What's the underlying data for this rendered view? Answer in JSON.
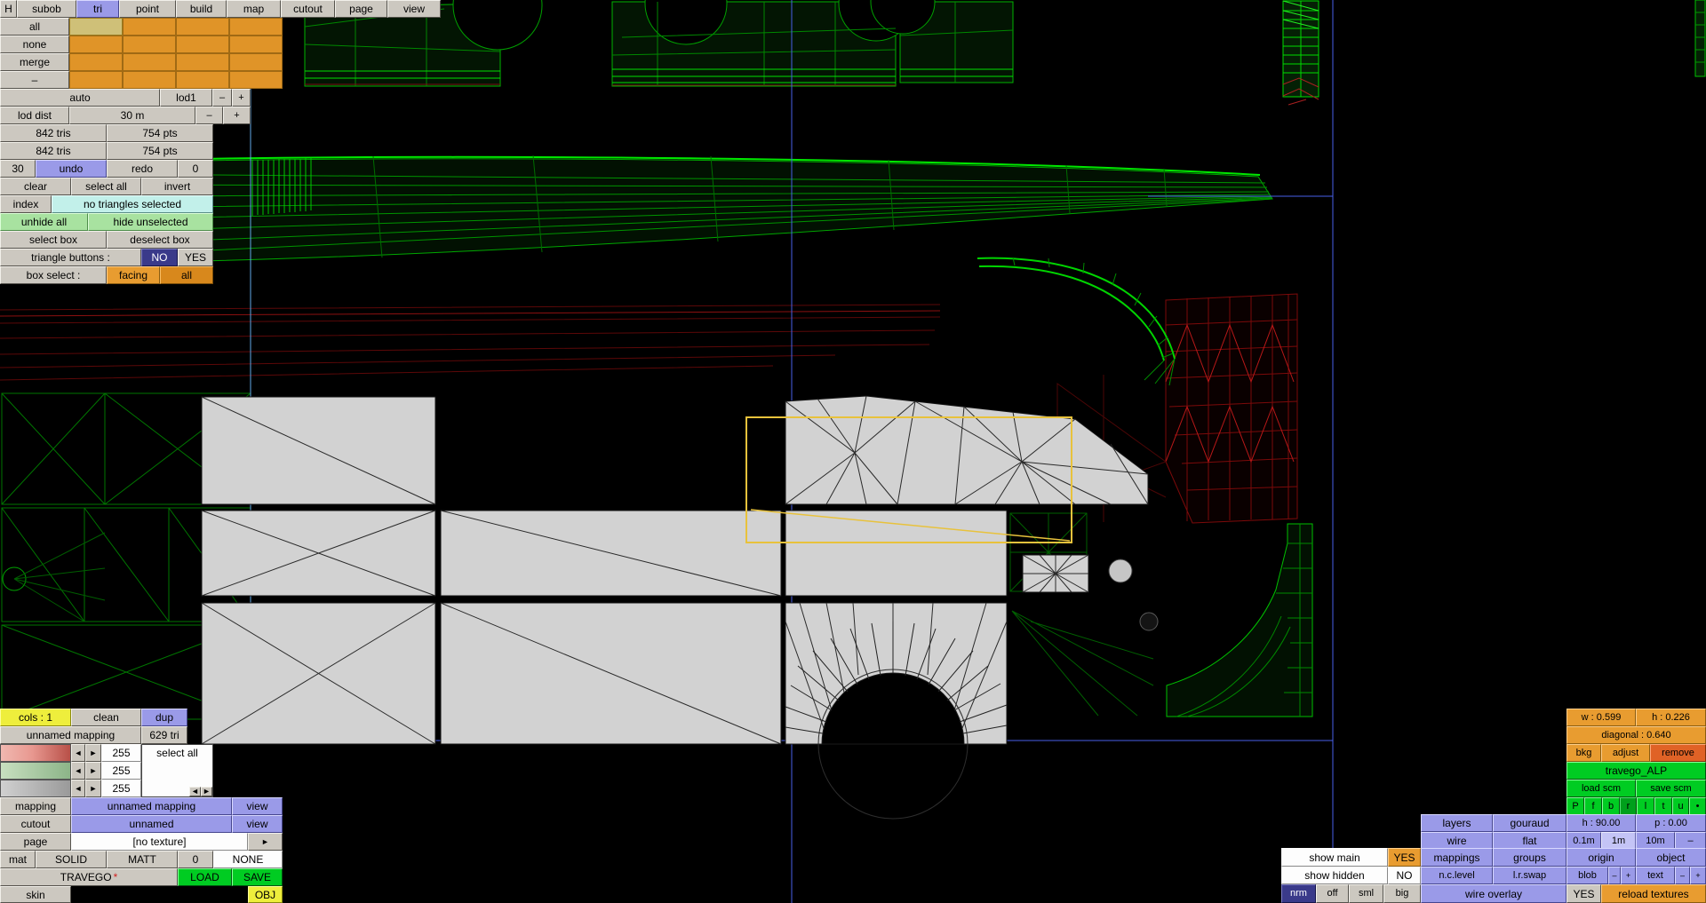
{
  "colors": {
    "accent_orange": "#e89c30",
    "accent_periwinkle": "#9a9ae8",
    "accent_green": "#00cc22",
    "selection_yellow": "#e8c23c",
    "wire_green": "#00b400",
    "guide_blue": "#4860e8"
  },
  "menu": {
    "items": [
      "H",
      "subob",
      "tri",
      "point",
      "build",
      "map",
      "cutout",
      "page",
      "view"
    ]
  },
  "subobj": {
    "row_labels": [
      "all",
      "none",
      "merge",
      "–"
    ]
  },
  "lod": {
    "auto": "auto",
    "lod1": "lod1",
    "minus": "–",
    "plus": "+",
    "dist_label": "lod dist",
    "dist_value": "30 m"
  },
  "stats": {
    "tris1": "842 tris",
    "pts1": "754 pts",
    "tris2": "842 tris",
    "pts2": "754 pts"
  },
  "history": {
    "undo_steps": "30",
    "undo": "undo",
    "redo": "redo",
    "redo_steps": "0"
  },
  "selection": {
    "clear": "clear",
    "select_all": "select all",
    "invert": "invert",
    "index": "index",
    "status": "no triangles selected",
    "unhide_all": "unhide all",
    "hide_unselected": "hide unselected",
    "select_box": "select box",
    "deselect_box": "deselect box",
    "triangle_buttons_label": "triangle buttons :",
    "no": "NO",
    "yes": "YES",
    "box_select_label": "box select :",
    "facing": "facing",
    "all": "all"
  },
  "mapping": {
    "cols": "cols : 1",
    "clean": "clean",
    "dup": "dup",
    "name": "unnamed mapping",
    "tris": "629 tri",
    "select_all": "select all",
    "left": "◄",
    "right": "►",
    "ch1": "255",
    "ch2": "255",
    "ch3": "255",
    "mapping_label": "mapping",
    "mapping_value": "unnamed mapping",
    "mapping_view": "view",
    "cutout_label": "cutout",
    "cutout_value": "unnamed",
    "cutout_view": "view",
    "page_label": "page",
    "page_value": "[no texture]",
    "page_next": "►",
    "mat_label": "mat",
    "mat_solid": "SOLID",
    "mat_matt": "MATT",
    "mat_zero": "0",
    "mat_none": "NONE",
    "file_name": "TRAVEGO",
    "file_star": "*",
    "load": "LOAD",
    "save": "SAVE",
    "skin": "skin",
    "obj": "OBJ"
  },
  "background": {
    "w": "w : 0.599",
    "h": "h : 0.226",
    "diagonal": "diagonal : 0.640",
    "bkg": "bkg",
    "adjust": "adjust",
    "remove": "remove",
    "texture": "travego_ALP",
    "load_scm": "load scm",
    "save_scm": "save scm",
    "views": [
      "P",
      "f",
      "b",
      "r",
      "l",
      "t",
      "u",
      "•"
    ]
  },
  "display": {
    "layers": "layers",
    "gouraud": "gouraud",
    "heading": "h : 90.00",
    "pitch": "p : 0.00",
    "wire": "wire",
    "flat": "flat",
    "grid_01": "0.1m",
    "grid_1": "1m",
    "grid_10": "10m",
    "grid_minus": "–"
  },
  "show": {
    "show_main": "show main",
    "show_main_val": "YES",
    "mappings": "mappings",
    "groups": "groups",
    "origin": "origin",
    "object": "object",
    "show_hidden": "show hidden",
    "show_hidden_val": "NO",
    "nc_level": "n.c.level",
    "lr_swap": "l.r.swap",
    "blob": "blob",
    "blob_minus": "–",
    "blob_plus": "+",
    "text": "text",
    "text_minus": "–",
    "text_plus": "+",
    "nrm": "nrm",
    "off": "off",
    "sml": "sml",
    "big": "big",
    "wire_overlay": "wire overlay",
    "wire_overlay_val": "YES",
    "reload": "reload textures"
  }
}
